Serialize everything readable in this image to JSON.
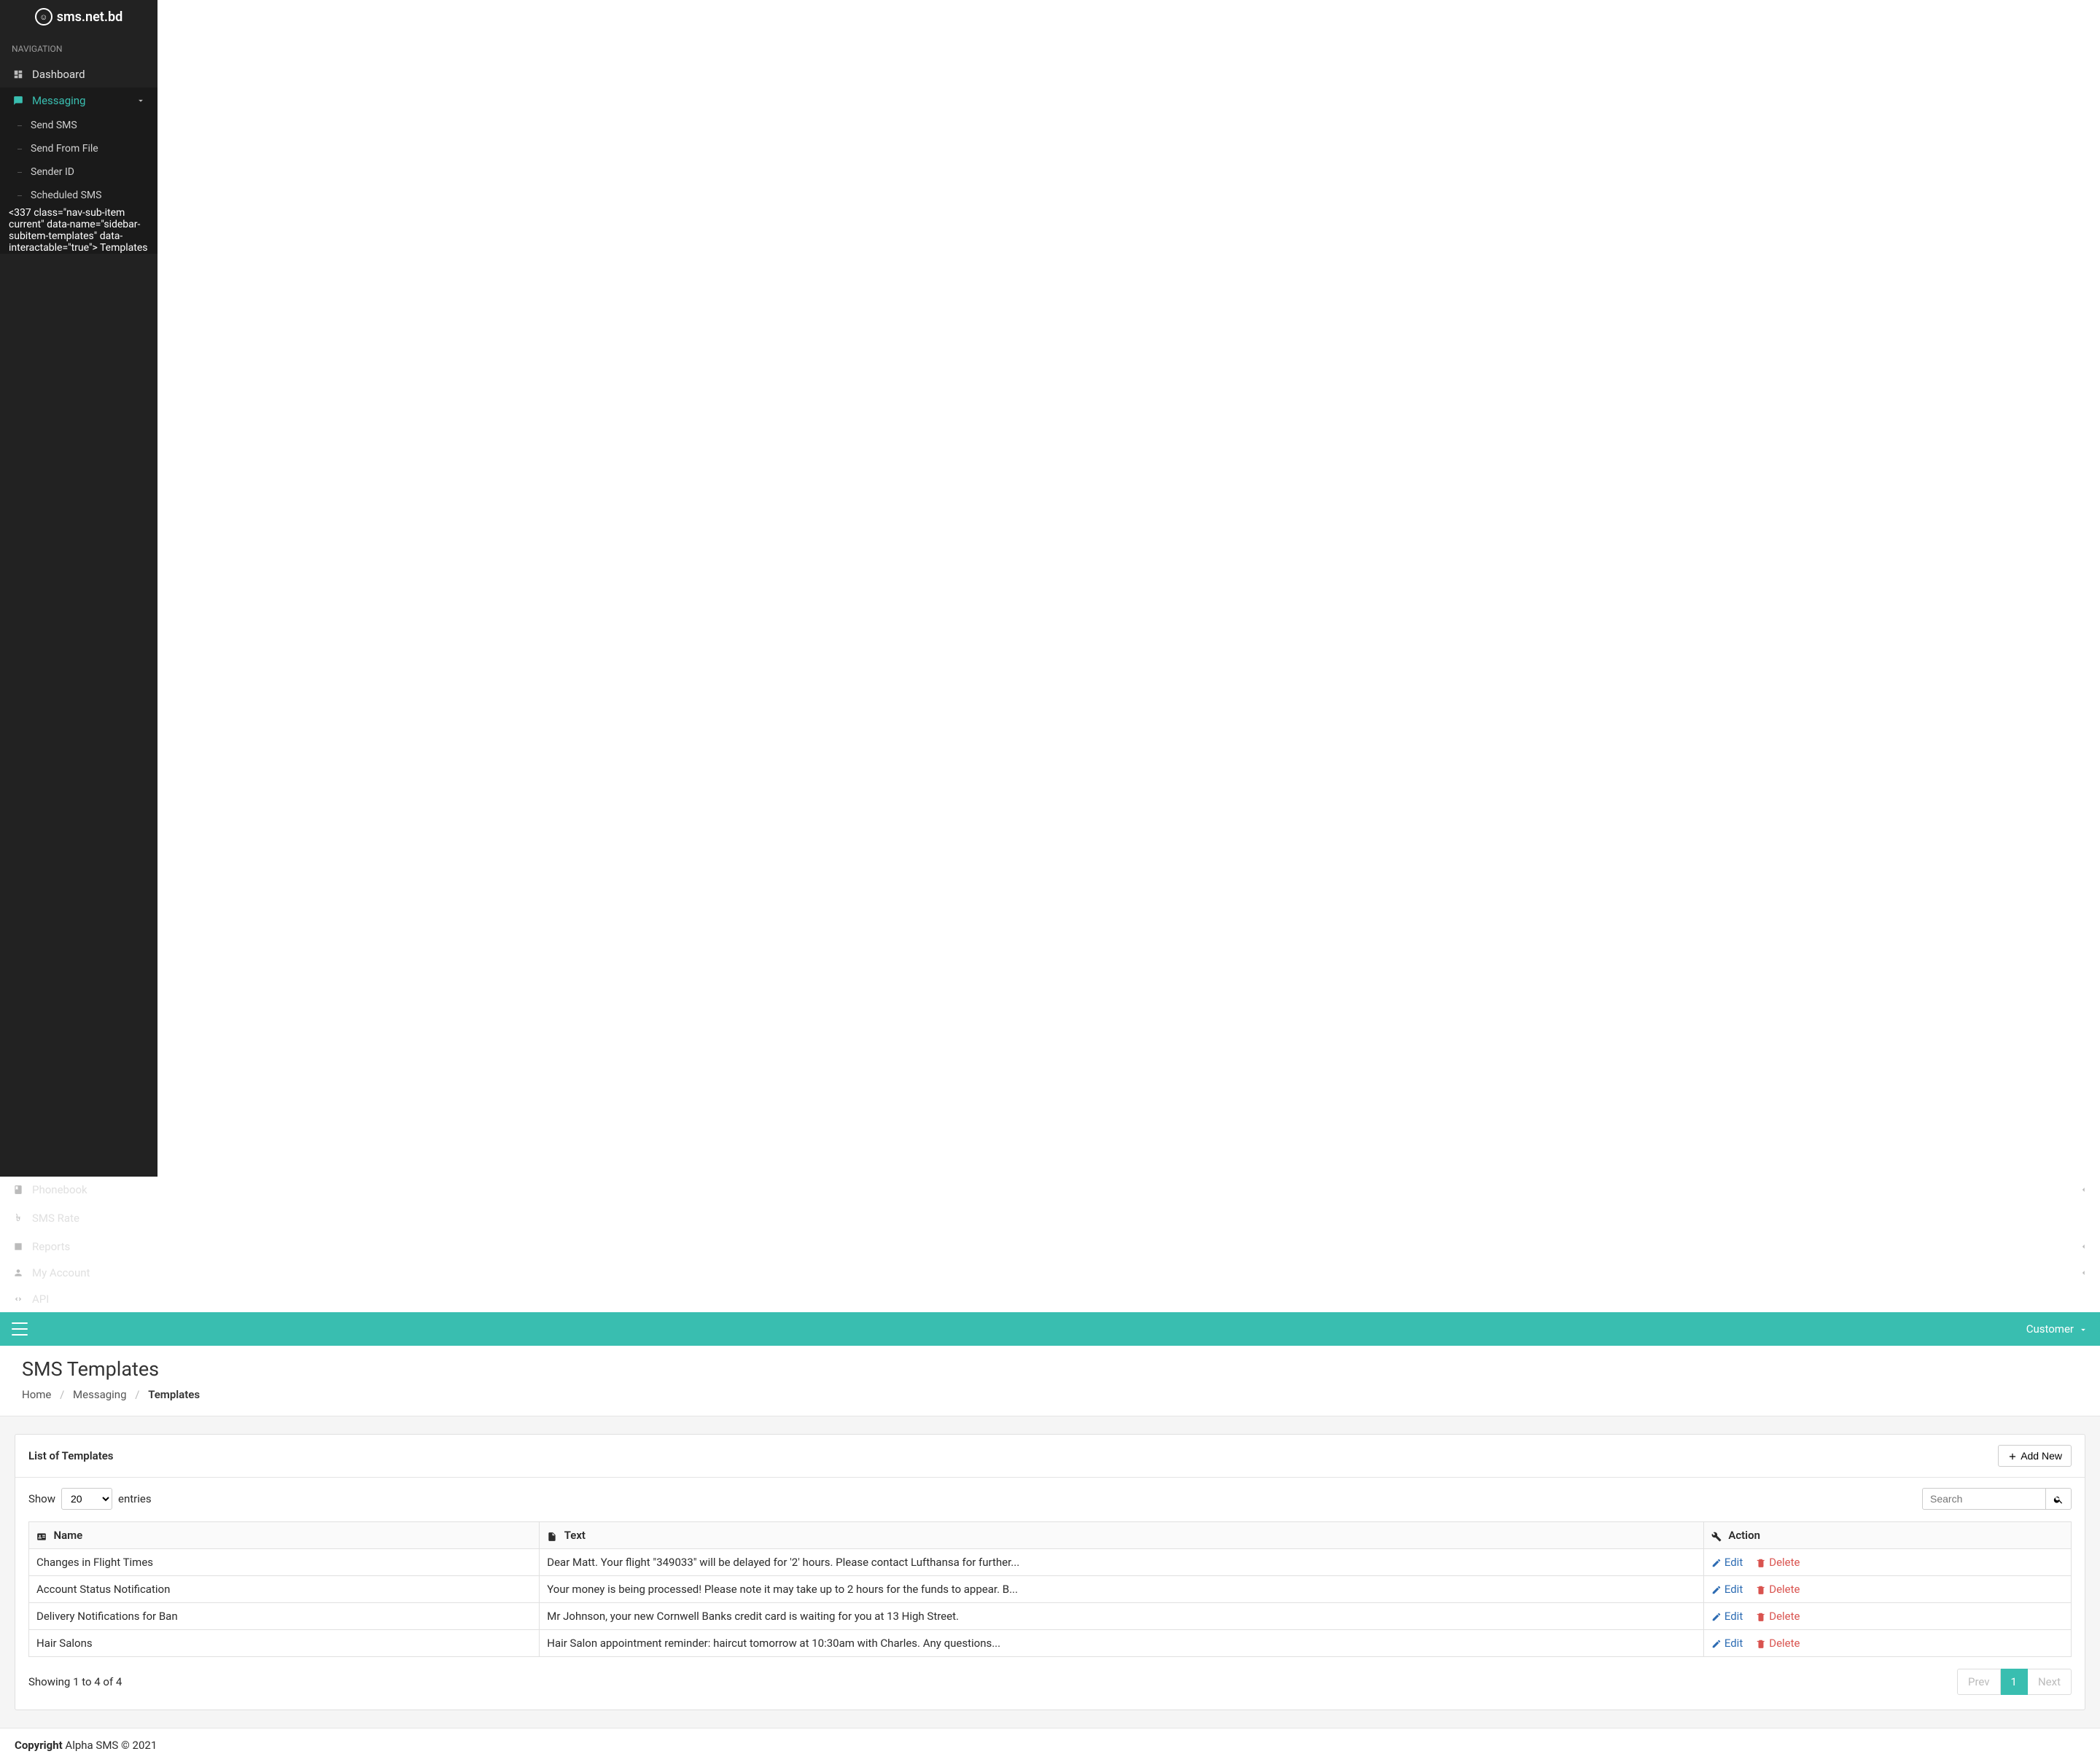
{
  "logo_text": "sms.net.bd",
  "nav_header": "NAVIGATION",
  "sidebar": {
    "items": [
      {
        "label": "Dashboard",
        "icon": "dashboard"
      },
      {
        "label": "Messaging",
        "icon": "chat",
        "expandable": true
      },
      {
        "label": "Phonebook",
        "icon": "book",
        "expandable": true
      },
      {
        "label": "SMS Rate",
        "icon": "bdt"
      },
      {
        "label": "Reports",
        "icon": "reports",
        "expandable": true
      },
      {
        "label": "My Account",
        "icon": "user",
        "expandable": true
      },
      {
        "label": "API",
        "icon": "code"
      }
    ],
    "messaging_sub": [
      {
        "label": "Send SMS"
      },
      {
        "label": "Send From File"
      },
      {
        "label": "Sender ID"
      },
      {
        "label": "Scheduled SMS"
      },
      {
        "label": "Templates"
      }
    ]
  },
  "topbar": {
    "user_menu_label": "Customer"
  },
  "page": {
    "title": "SMS Templates",
    "breadcrumb": {
      "home": "Home",
      "messaging": "Messaging",
      "current": "Templates"
    }
  },
  "panel": {
    "title": "List of Templates",
    "add_button": "Add New",
    "show_label_pre": "Show",
    "show_label_post": "entries",
    "show_value": "20",
    "search_placeholder": "Search",
    "columns": {
      "name": "Name",
      "text": "Text",
      "action": "Action"
    },
    "rows": [
      {
        "name": "Changes in Flight Times",
        "text": "Dear Matt. Your flight \"349033\" will be delayed for '2' hours. Please contact Lufthansa for further..."
      },
      {
        "name": "Account Status Notification",
        "text": "Your money is being processed! Please note it may take up to 2 hours for the funds to appear. B..."
      },
      {
        "name": "Delivery Notifications for Ban",
        "text": "Mr Johnson, your new Cornwell Banks credit card is waiting for you at 13 High Street."
      },
      {
        "name": "Hair Salons",
        "text": "Hair Salon appointment reminder: haircut tomorrow at 10:30am with Charles. Any questions..."
      }
    ],
    "action_edit": "Edit",
    "action_delete": "Delete",
    "showing_text": "Showing 1 to 4 of 4",
    "pagination": {
      "prev": "Prev",
      "current": "1",
      "next": "Next"
    }
  },
  "footer": {
    "strong": "Copyright",
    "rest": " Alpha SMS © 2021"
  }
}
